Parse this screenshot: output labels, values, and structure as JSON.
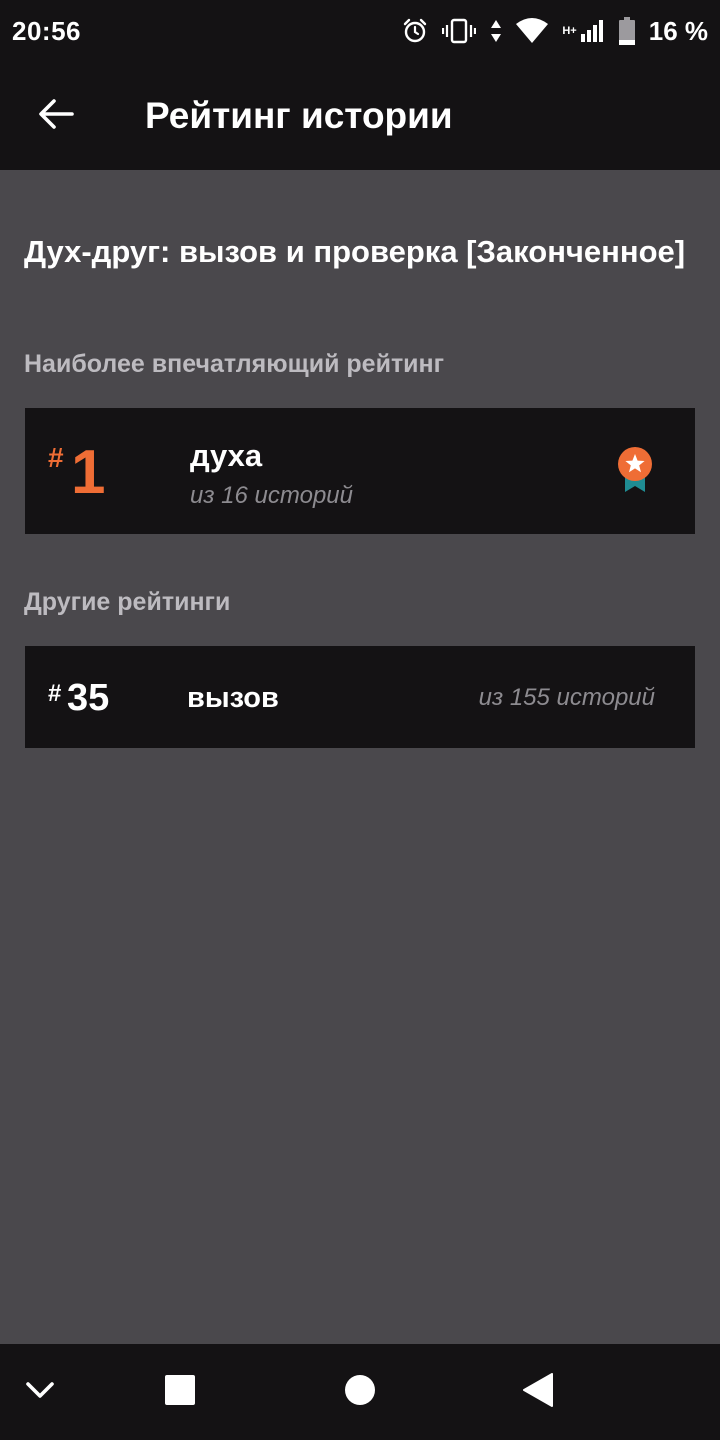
{
  "status_bar": {
    "time": "20:56",
    "network": "H+",
    "battery": "16 %",
    "icons": [
      "alarm-icon",
      "vibrate-icon",
      "data-arrows-icon",
      "wifi-icon",
      "signal-icon",
      "battery-icon"
    ]
  },
  "app_bar": {
    "back_icon": "arrow-left-icon",
    "title": "Рейтинг истории"
  },
  "story": {
    "title": "Дух-друг: вызов и проверка [Законченное]"
  },
  "top_ranking": {
    "section_label": "Наиболее впечатляющий рейтинг",
    "hash": "#",
    "rank": "1",
    "tag": "духа",
    "of_total": "из 16 историй",
    "icon": "medal-icon",
    "accent_color": "#ef6d35"
  },
  "other_rankings": {
    "section_label": "Другие рейтинги",
    "items": [
      {
        "hash": "#",
        "rank": "35",
        "tag": "вызов",
        "of_total": "из 155 историй"
      }
    ]
  },
  "nav_bar": {
    "buttons": [
      "chevron-down-icon",
      "recents-square-icon",
      "home-circle-icon",
      "back-triangle-icon"
    ]
  },
  "colors": {
    "background": "#4a484c",
    "bars": "#141214",
    "card": "#141214",
    "muted_text": "#8d8b90",
    "section_text": "#bdbbc0"
  }
}
